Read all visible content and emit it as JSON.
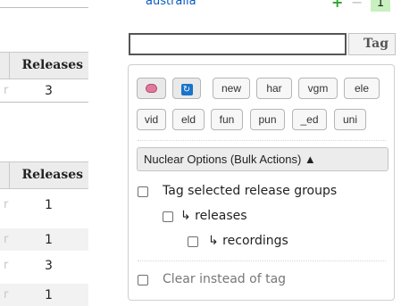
{
  "left_tables": {
    "first": {
      "header": "Releases",
      "rows": [
        {
          "cut": "r",
          "value": "3"
        }
      ]
    },
    "second": {
      "header": "Releases",
      "rows": [
        {
          "cut": "r",
          "value": "1"
        },
        {
          "cut": "r",
          "value": "1"
        },
        {
          "cut": "r",
          "value": "3"
        },
        {
          "cut": "r",
          "value": "1"
        }
      ]
    }
  },
  "country_row": {
    "name": "australia",
    "plus": "+",
    "minus": "−",
    "count": "1"
  },
  "tag_form": {
    "input_value": "",
    "button_label": "Tag"
  },
  "quick_tags": {
    "row1": [
      "new",
      "har",
      "vgm",
      "ele"
    ],
    "row2": [
      "vid",
      "eld",
      "fun",
      "pun",
      "_ed",
      "uni"
    ],
    "icons": [
      "brain-icon",
      "refresh-icon"
    ]
  },
  "nuclear": {
    "label": "Nuclear Options (Bulk Actions) ▲",
    "options": {
      "tag_groups": "Tag selected release groups",
      "releases": "↳ releases",
      "recordings": "↳ recordings",
      "clear": "Clear instead of tag"
    }
  },
  "colors": {
    "link": "#0a5dc2",
    "plus": "#2aa52a",
    "count_bg": "#c8f0c0",
    "header_bg": "#ececec"
  }
}
